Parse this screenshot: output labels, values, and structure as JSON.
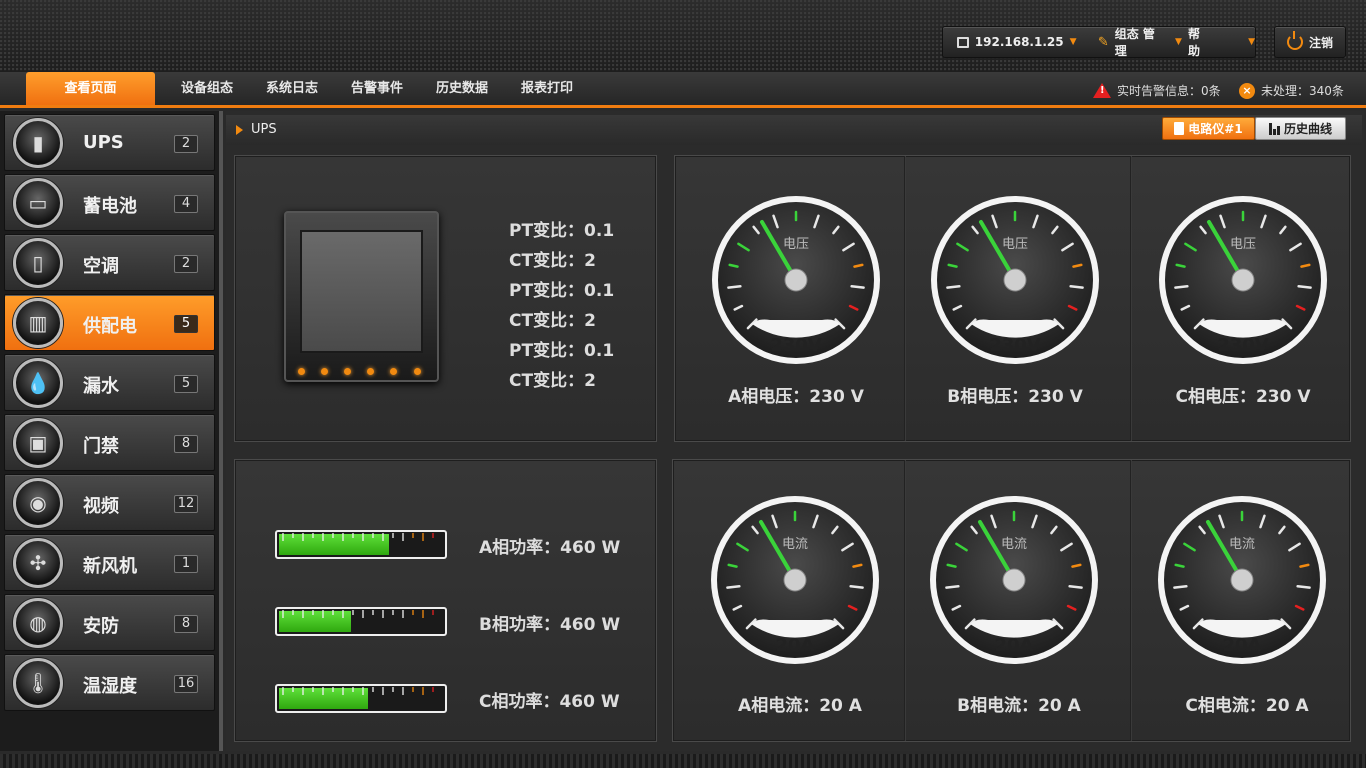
{
  "header": {
    "ip": "192.168.1.25",
    "config_manage": "组态 管理",
    "help": "帮助",
    "logout": "注销"
  },
  "nav": {
    "tabs": [
      "查看页面",
      "设备组态",
      "系统日志",
      "告警事件",
      "历史数据",
      "报表打印"
    ],
    "active_tab": "查看页面",
    "alarm_info": "实时告警信息：0条",
    "unhandled": "未处理：340条"
  },
  "sidebar": {
    "items": [
      {
        "label": "UPS",
        "count": "2",
        "icon": "ups-icon"
      },
      {
        "label": "蓄电池",
        "count": "4",
        "icon": "battery-icon"
      },
      {
        "label": "空调",
        "count": "2",
        "icon": "air-conditioner-icon"
      },
      {
        "label": "供配电",
        "count": "5",
        "icon": "power-distribution-icon"
      },
      {
        "label": "漏水",
        "count": "5",
        "icon": "water-leak-icon"
      },
      {
        "label": "门禁",
        "count": "8",
        "icon": "access-control-icon"
      },
      {
        "label": "视频",
        "count": "12",
        "icon": "camera-icon"
      },
      {
        "label": "新风机",
        "count": "1",
        "icon": "fan-icon"
      },
      {
        "label": "安防",
        "count": "8",
        "icon": "security-icon"
      },
      {
        "label": "温湿度",
        "count": "16",
        "icon": "thermometer-icon"
      }
    ],
    "active_index": 3
  },
  "main": {
    "breadcrumb": "UPS",
    "device_button": "电路仪#1",
    "history_button": "历史曲线",
    "ratios": [
      "PT变比：0.1",
      "CT变比：2",
      "PT变比：0.1",
      "CT变比：2",
      "PT变比：0.1",
      "CT变比：2"
    ],
    "voltage_gauges": [
      {
        "label": "电压",
        "readout": "230V",
        "caption": "A相电压：230 V",
        "value": 230
      },
      {
        "label": "电压",
        "readout": "230V",
        "caption": "B相电压：230 V",
        "value": 230
      },
      {
        "label": "电压",
        "readout": "230V",
        "caption": "C相电压：230 V",
        "value": 230
      }
    ],
    "current_gauges": [
      {
        "label": "电流",
        "readout": "20A",
        "caption": "A相电流：20 A",
        "value": 20
      },
      {
        "label": "电流",
        "readout": "20A",
        "caption": "B相电流：20 A",
        "value": 20
      },
      {
        "label": "电流",
        "readout": "20A",
        "caption": "C相电流：20 A",
        "value": 20
      }
    ],
    "power_bars": [
      {
        "caption": "A相功率：460 W",
        "fill": 0.67
      },
      {
        "caption": "B相功率：460 W",
        "fill": 0.44
      },
      {
        "caption": "C相功率：460 W",
        "fill": 0.54
      }
    ]
  },
  "colors": {
    "accent": "#f07c10",
    "gauge_needle": "#3ad33a",
    "alarm": "#e52020"
  }
}
